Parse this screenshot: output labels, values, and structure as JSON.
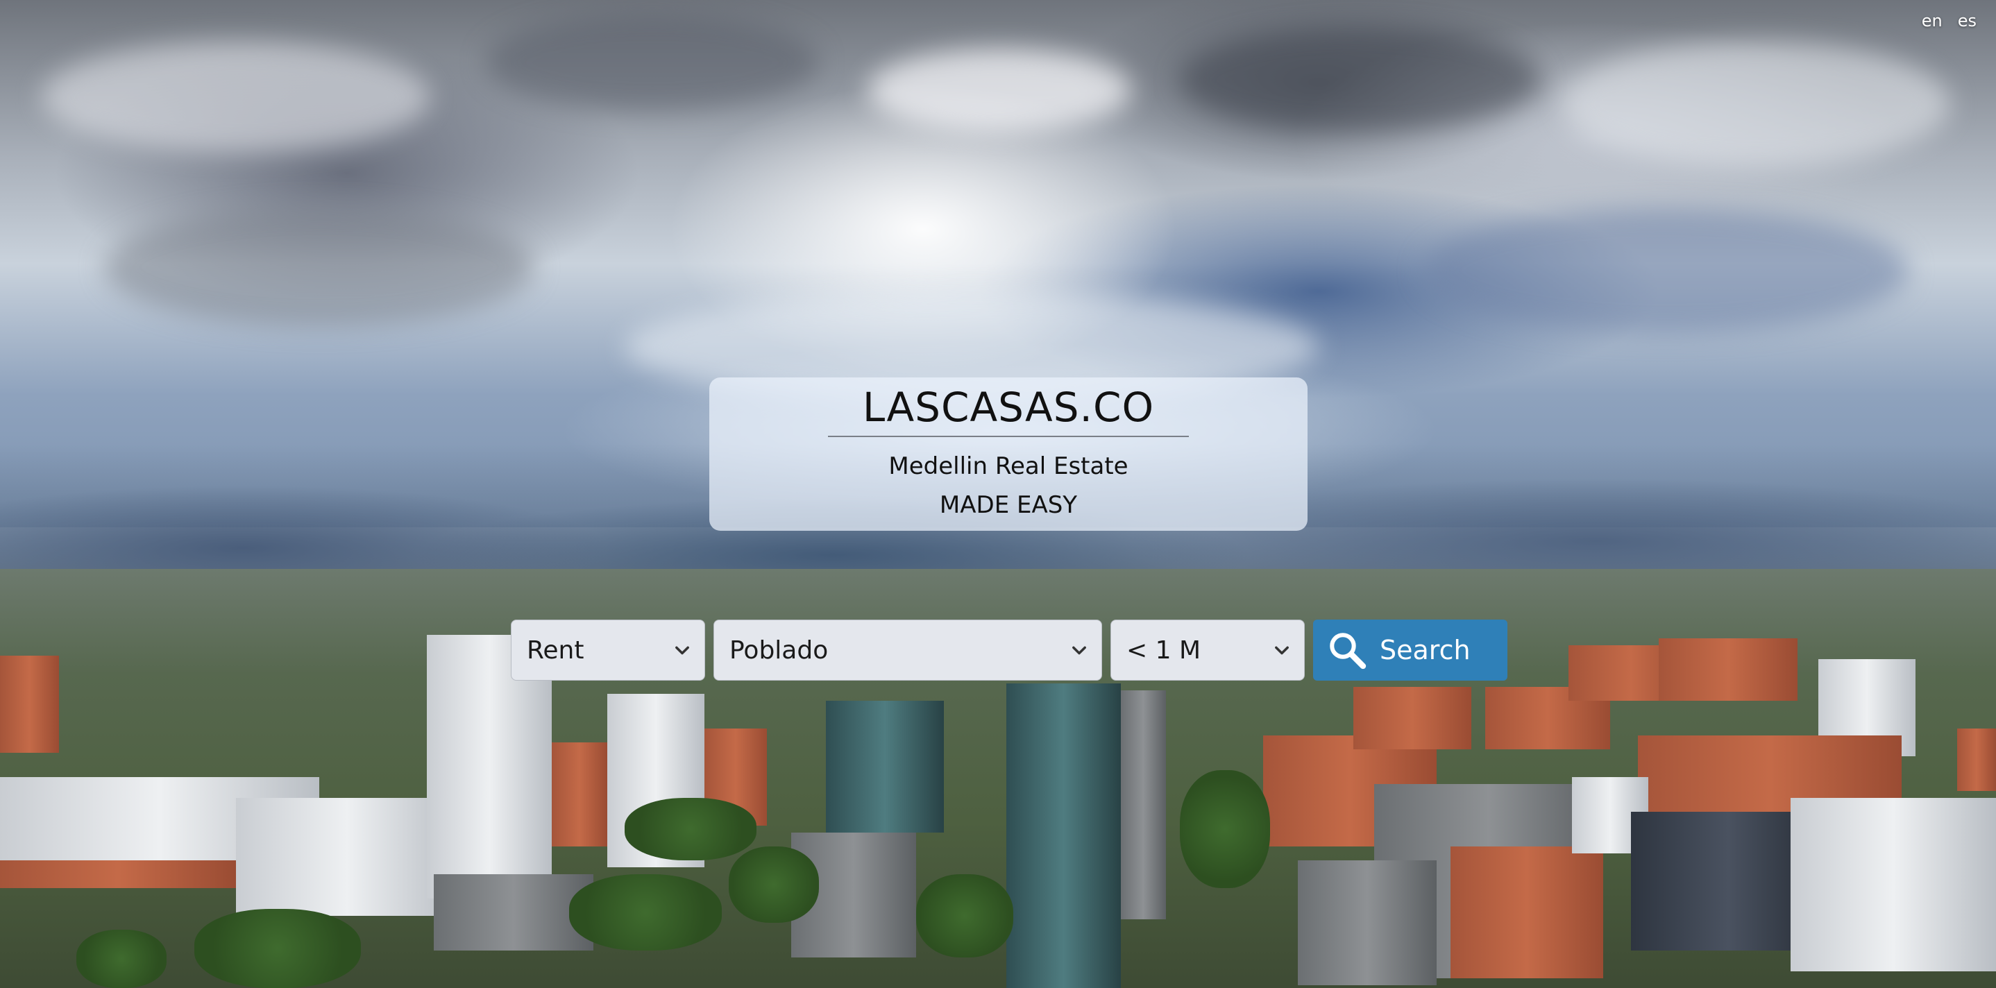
{
  "language_switcher": {
    "options": [
      "en",
      "es"
    ]
  },
  "hero": {
    "brand": "LASCASAS.CO",
    "tagline": "Medellin Real Estate",
    "subtagline": "MADE EASY"
  },
  "search": {
    "operation": {
      "selected": "Rent"
    },
    "neighborhood": {
      "selected": "Poblado"
    },
    "price": {
      "selected": "< 1 M"
    },
    "button_label": "Search"
  },
  "colors": {
    "search_button": "#2f80b8",
    "select_background": "#e4e7ed",
    "card_background": "#ecf2fc"
  },
  "icons": {
    "search": "search-icon",
    "dropdown": "chevron-down-icon"
  }
}
